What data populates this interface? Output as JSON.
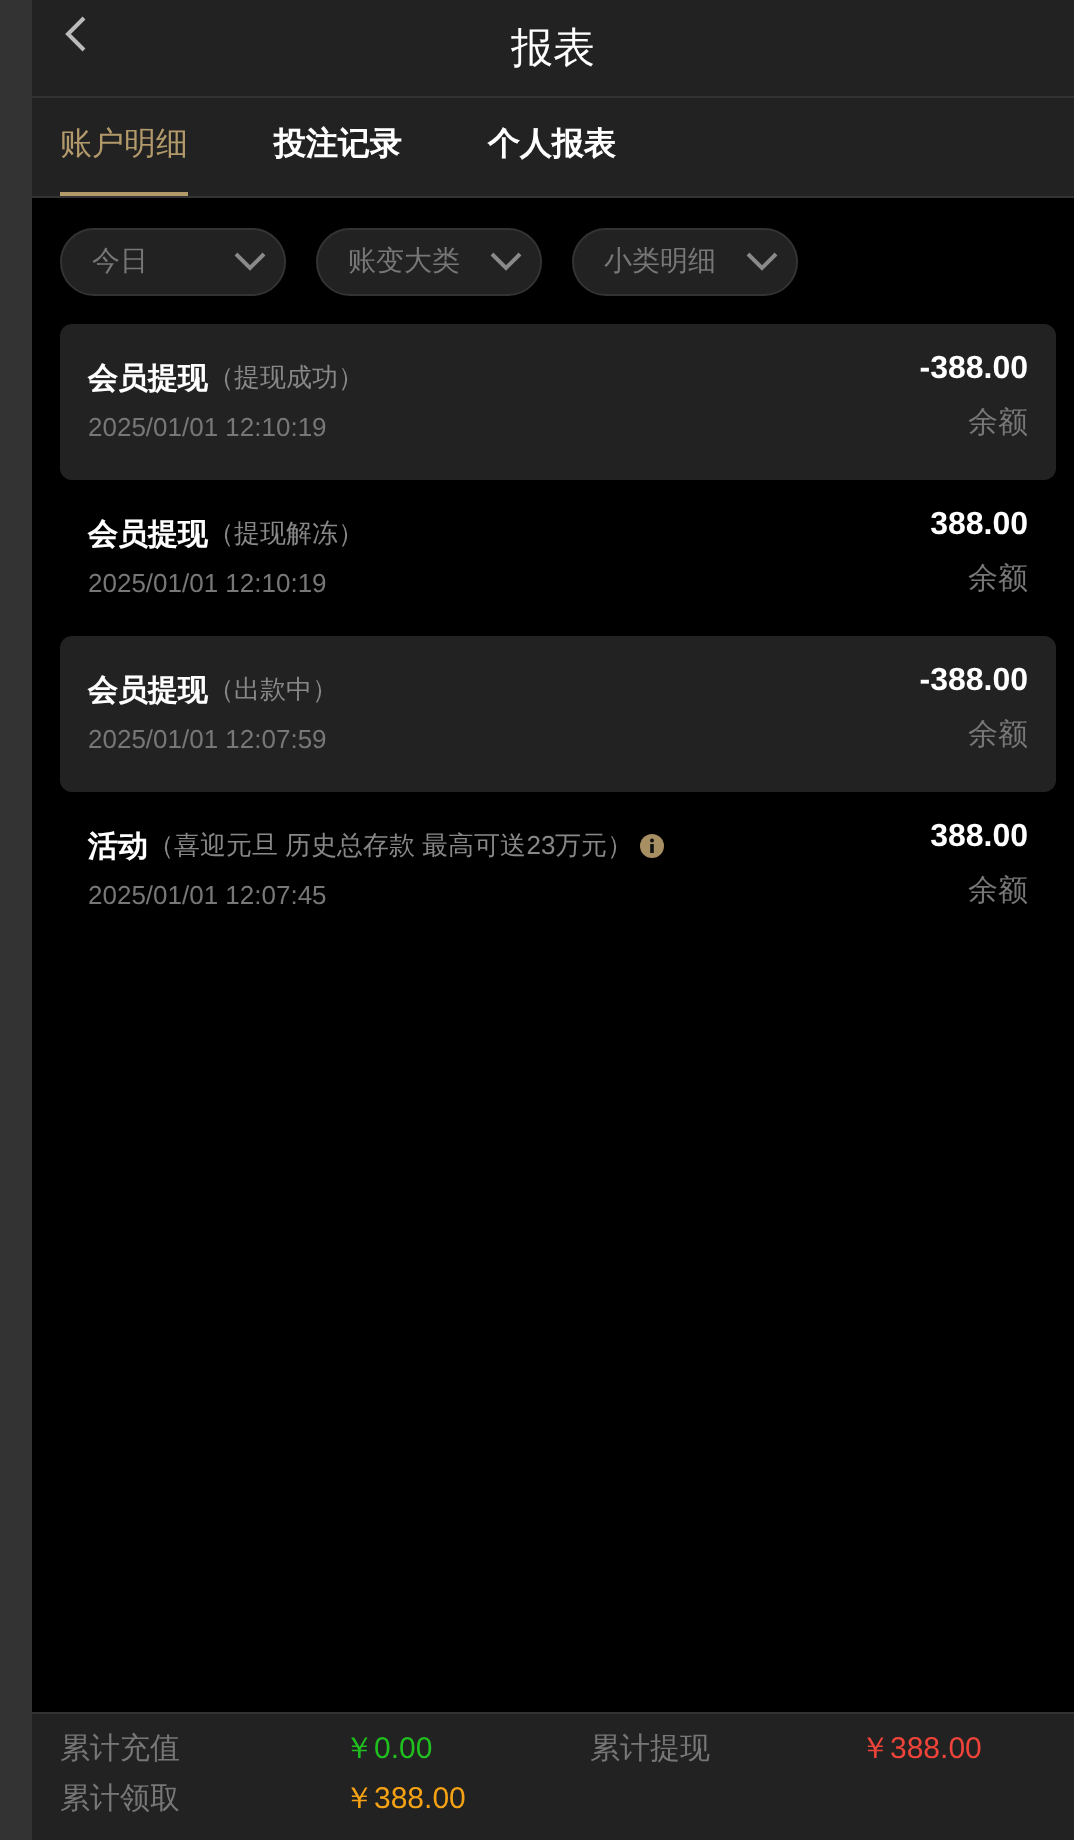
{
  "header": {
    "title": "报表"
  },
  "tabs": [
    {
      "label": "账户明细",
      "selected": true
    },
    {
      "label": "投注记录",
      "selected": false
    },
    {
      "label": "个人报表",
      "selected": false
    }
  ],
  "filters": [
    {
      "label": "今日"
    },
    {
      "label": "账变大类"
    },
    {
      "label": "小类明细"
    }
  ],
  "records": [
    {
      "title": "会员提现",
      "note": "（提现成功）",
      "time": "2025/01/01 12:10:19",
      "amount": "-388.00",
      "balance_label": "余额",
      "shaded": true,
      "info": false
    },
    {
      "title": "会员提现",
      "note": "（提现解冻）",
      "time": "2025/01/01 12:10:19",
      "amount": "388.00",
      "balance_label": "余额",
      "shaded": false,
      "info": false
    },
    {
      "title": "会员提现",
      "note": "（出款中）",
      "time": "2025/01/01 12:07:59",
      "amount": "-388.00",
      "balance_label": "余额",
      "shaded": true,
      "info": false
    },
    {
      "title": "活动",
      "note": "（喜迎元旦 历史总存款 最高可送23万元）",
      "time": "2025/01/01 12:07:45",
      "amount": "388.00",
      "balance_label": "余额",
      "shaded": false,
      "info": true
    }
  ],
  "summary": [
    {
      "label": "累计充值",
      "value": "￥0.00",
      "color": "#1fc01f"
    },
    {
      "label": "累计提现",
      "value": "￥388.00",
      "color": "#f0443a"
    },
    {
      "label": "累计领取",
      "value": "￥388.00",
      "color": "#f5a214"
    }
  ]
}
